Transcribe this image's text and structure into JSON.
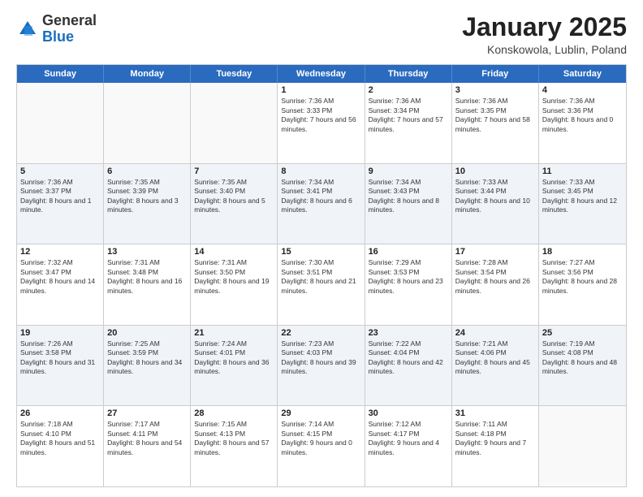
{
  "header": {
    "logo_general": "General",
    "logo_blue": "Blue",
    "month_title": "January 2025",
    "location": "Konskowola, Lublin, Poland"
  },
  "weekdays": [
    "Sunday",
    "Monday",
    "Tuesday",
    "Wednesday",
    "Thursday",
    "Friday",
    "Saturday"
  ],
  "rows": [
    {
      "alt": false,
      "cells": [
        {
          "day": "",
          "text": ""
        },
        {
          "day": "",
          "text": ""
        },
        {
          "day": "",
          "text": ""
        },
        {
          "day": "1",
          "text": "Sunrise: 7:36 AM\nSunset: 3:33 PM\nDaylight: 7 hours and 56 minutes."
        },
        {
          "day": "2",
          "text": "Sunrise: 7:36 AM\nSunset: 3:34 PM\nDaylight: 7 hours and 57 minutes."
        },
        {
          "day": "3",
          "text": "Sunrise: 7:36 AM\nSunset: 3:35 PM\nDaylight: 7 hours and 58 minutes."
        },
        {
          "day": "4",
          "text": "Sunrise: 7:36 AM\nSunset: 3:36 PM\nDaylight: 8 hours and 0 minutes."
        }
      ]
    },
    {
      "alt": true,
      "cells": [
        {
          "day": "5",
          "text": "Sunrise: 7:36 AM\nSunset: 3:37 PM\nDaylight: 8 hours and 1 minute."
        },
        {
          "day": "6",
          "text": "Sunrise: 7:35 AM\nSunset: 3:39 PM\nDaylight: 8 hours and 3 minutes."
        },
        {
          "day": "7",
          "text": "Sunrise: 7:35 AM\nSunset: 3:40 PM\nDaylight: 8 hours and 5 minutes."
        },
        {
          "day": "8",
          "text": "Sunrise: 7:34 AM\nSunset: 3:41 PM\nDaylight: 8 hours and 6 minutes."
        },
        {
          "day": "9",
          "text": "Sunrise: 7:34 AM\nSunset: 3:43 PM\nDaylight: 8 hours and 8 minutes."
        },
        {
          "day": "10",
          "text": "Sunrise: 7:33 AM\nSunset: 3:44 PM\nDaylight: 8 hours and 10 minutes."
        },
        {
          "day": "11",
          "text": "Sunrise: 7:33 AM\nSunset: 3:45 PM\nDaylight: 8 hours and 12 minutes."
        }
      ]
    },
    {
      "alt": false,
      "cells": [
        {
          "day": "12",
          "text": "Sunrise: 7:32 AM\nSunset: 3:47 PM\nDaylight: 8 hours and 14 minutes."
        },
        {
          "day": "13",
          "text": "Sunrise: 7:31 AM\nSunset: 3:48 PM\nDaylight: 8 hours and 16 minutes."
        },
        {
          "day": "14",
          "text": "Sunrise: 7:31 AM\nSunset: 3:50 PM\nDaylight: 8 hours and 19 minutes."
        },
        {
          "day": "15",
          "text": "Sunrise: 7:30 AM\nSunset: 3:51 PM\nDaylight: 8 hours and 21 minutes."
        },
        {
          "day": "16",
          "text": "Sunrise: 7:29 AM\nSunset: 3:53 PM\nDaylight: 8 hours and 23 minutes."
        },
        {
          "day": "17",
          "text": "Sunrise: 7:28 AM\nSunset: 3:54 PM\nDaylight: 8 hours and 26 minutes."
        },
        {
          "day": "18",
          "text": "Sunrise: 7:27 AM\nSunset: 3:56 PM\nDaylight: 8 hours and 28 minutes."
        }
      ]
    },
    {
      "alt": true,
      "cells": [
        {
          "day": "19",
          "text": "Sunrise: 7:26 AM\nSunset: 3:58 PM\nDaylight: 8 hours and 31 minutes."
        },
        {
          "day": "20",
          "text": "Sunrise: 7:25 AM\nSunset: 3:59 PM\nDaylight: 8 hours and 34 minutes."
        },
        {
          "day": "21",
          "text": "Sunrise: 7:24 AM\nSunset: 4:01 PM\nDaylight: 8 hours and 36 minutes."
        },
        {
          "day": "22",
          "text": "Sunrise: 7:23 AM\nSunset: 4:03 PM\nDaylight: 8 hours and 39 minutes."
        },
        {
          "day": "23",
          "text": "Sunrise: 7:22 AM\nSunset: 4:04 PM\nDaylight: 8 hours and 42 minutes."
        },
        {
          "day": "24",
          "text": "Sunrise: 7:21 AM\nSunset: 4:06 PM\nDaylight: 8 hours and 45 minutes."
        },
        {
          "day": "25",
          "text": "Sunrise: 7:19 AM\nSunset: 4:08 PM\nDaylight: 8 hours and 48 minutes."
        }
      ]
    },
    {
      "alt": false,
      "cells": [
        {
          "day": "26",
          "text": "Sunrise: 7:18 AM\nSunset: 4:10 PM\nDaylight: 8 hours and 51 minutes."
        },
        {
          "day": "27",
          "text": "Sunrise: 7:17 AM\nSunset: 4:11 PM\nDaylight: 8 hours and 54 minutes."
        },
        {
          "day": "28",
          "text": "Sunrise: 7:15 AM\nSunset: 4:13 PM\nDaylight: 8 hours and 57 minutes."
        },
        {
          "day": "29",
          "text": "Sunrise: 7:14 AM\nSunset: 4:15 PM\nDaylight: 9 hours and 0 minutes."
        },
        {
          "day": "30",
          "text": "Sunrise: 7:12 AM\nSunset: 4:17 PM\nDaylight: 9 hours and 4 minutes."
        },
        {
          "day": "31",
          "text": "Sunrise: 7:11 AM\nSunset: 4:18 PM\nDaylight: 9 hours and 7 minutes."
        },
        {
          "day": "",
          "text": ""
        }
      ]
    }
  ]
}
